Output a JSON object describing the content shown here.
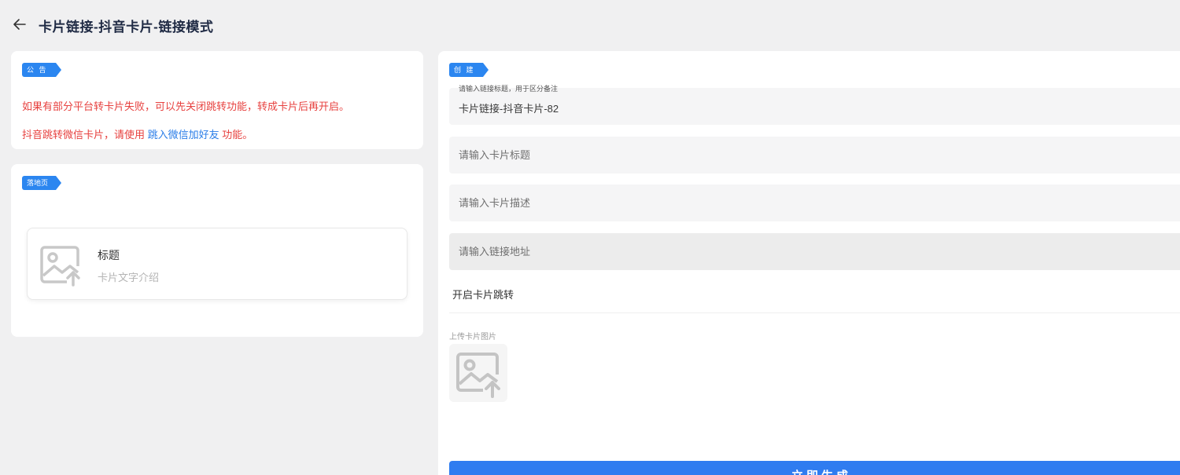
{
  "header": {
    "title": "卡片链接-抖音卡片-链接模式",
    "back_icon": "arrow-left-icon"
  },
  "notice": {
    "tag": "公 告",
    "line1": "如果有部分平台转卡片失败，可以先关闭跳转功能，转成卡片后再开启。",
    "line2_prefix": "抖音跳转微信卡片，请使用 ",
    "line2_link": "跳入微信加好友",
    "line2_suffix": " 功能。"
  },
  "landing": {
    "tag": "落地页",
    "preview_title": "标题",
    "preview_desc": "卡片文字介绍",
    "image_icon": "image-upload-icon"
  },
  "create": {
    "tag": "创 建",
    "link_title": {
      "label": "请输入链接标题，用于区分备注",
      "value": "卡片链接-抖音卡片-82"
    },
    "card_title_placeholder": "请输入卡片标题",
    "card_desc_placeholder": "请输入卡片描述",
    "link_url_placeholder": "请输入链接地址",
    "switch_label": "开启卡片跳转",
    "upload_label": "上传卡片图片",
    "submit_label": "立即生成"
  },
  "colors": {
    "accent": "#2b86f0",
    "notice_red": "#e7413f",
    "link_blue": "#2b7ee8",
    "background": "#f0f0f1"
  }
}
